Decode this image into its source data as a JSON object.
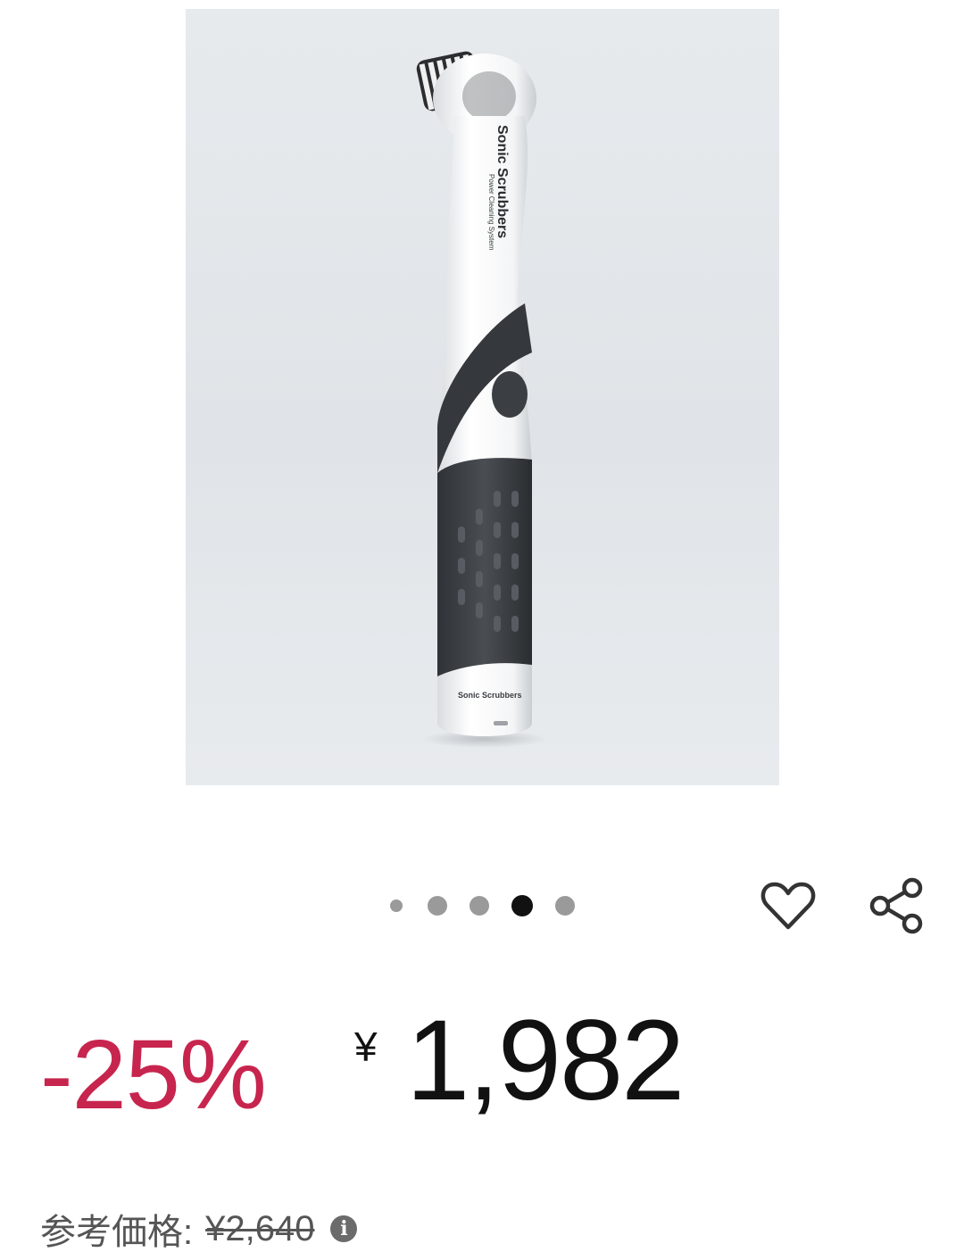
{
  "product_image": {
    "brand_text": "Sonic Scrubbers",
    "tagline_text": "Power Cleaning System",
    "base_logo_text": "Sonic Scrubbers"
  },
  "carousel": {
    "total": 5,
    "active_index": 3,
    "dots": [
      {
        "state": "inactive"
      },
      {
        "state": "inactive"
      },
      {
        "state": "inactive"
      },
      {
        "state": "active"
      },
      {
        "state": "inactive"
      }
    ]
  },
  "actions": {
    "wishlist_icon": "heart-icon",
    "share_icon": "share-icon"
  },
  "price": {
    "discount": "-25%",
    "currency_symbol": "¥",
    "amount": "1,982",
    "discount_color": "#c7254e"
  },
  "list_price": {
    "label": "参考価格:",
    "value": "¥2,640",
    "info_icon": "info-icon"
  }
}
